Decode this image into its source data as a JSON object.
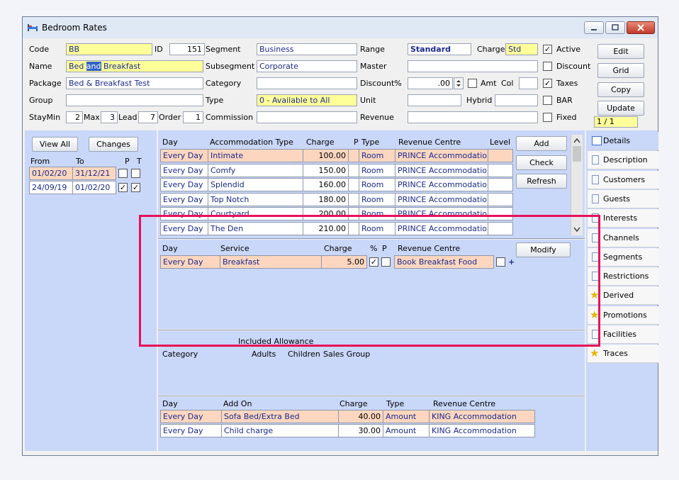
{
  "window": {
    "title": "Bedroom Rates"
  },
  "form": {
    "code_label": "Code",
    "code_value": "BB",
    "id_label": "ID",
    "id_value": "151",
    "segment_label": "Segment",
    "segment_value": "Business",
    "range_label": "Range",
    "range_value": "Standard",
    "charge_label": "Charge",
    "charge_value": "Std",
    "name_label": "Name",
    "name_pre": "Bed ",
    "name_sel": "and",
    "name_post": " Breakfast",
    "subsegment_label": "Subsegment",
    "subsegment_value": "Corporate",
    "master_label": "Master",
    "package_label": "Package",
    "package_value": "Bed & Breakfast Test",
    "category_label": "Category",
    "discount_label": "Discount%",
    "discount_value": ".00",
    "amt_label": "Amt",
    "col_label": "Col",
    "group_label": "Group",
    "type_label": "Type",
    "type_value": "0 - Available to All",
    "unit_label": "Unit",
    "hybrid_label": "Hybrid",
    "staymin_label": "StayMin",
    "staymin_value": "2",
    "max_label": "Max",
    "max_value": "3",
    "lead_label": "Lead",
    "lead_value": "7",
    "order_label": "Order",
    "order_value": "1",
    "commission_label": "Commission",
    "revenue_label": "Revenue"
  },
  "flags": {
    "active": "Active",
    "discount": "Discount",
    "taxes": "Taxes",
    "bar": "BAR",
    "fixed": "Fixed"
  },
  "actions": {
    "edit": "Edit",
    "grid": "Grid",
    "copy": "Copy",
    "update": "Update",
    "record_pos": "1 / 1"
  },
  "left": {
    "view_all": "View All",
    "changes": "Changes",
    "h_from": "From",
    "h_to": "To",
    "h_p": "P",
    "h_t": "T",
    "rows": [
      {
        "from": "01/02/20",
        "to": "31/12/21"
      },
      {
        "from": "24/09/19",
        "to": "01/02/20"
      }
    ]
  },
  "accommodation": {
    "h_day": "Day",
    "h_type": "Accommodation Type",
    "h_charge": "Charge",
    "h_p": "P",
    "h_ptype": "Type",
    "h_rev": "Revenue Centre",
    "h_level": "Level",
    "rows": [
      {
        "day": "Every Day",
        "type": "Intimate",
        "charge": "100.00",
        "ptype": "Room",
        "rev": "PRINCE Accommodatio"
      },
      {
        "day": "Every Day",
        "type": "Comfy",
        "charge": "150.00",
        "ptype": "Room",
        "rev": "PRINCE Accommodatio"
      },
      {
        "day": "Every Day",
        "type": "Splendid",
        "charge": "160.00",
        "ptype": "Room",
        "rev": "PRINCE Accommodatio"
      },
      {
        "day": "Every Day",
        "type": "Top Notch",
        "charge": "180.00",
        "ptype": "Room",
        "rev": "PRINCE Accommodatio"
      },
      {
        "day": "Every Day",
        "type": "Courtyard",
        "charge": "200.00",
        "ptype": "Room",
        "rev": "PRINCE Accommodatio"
      },
      {
        "day": "Every Day",
        "type": "The Den",
        "charge": "210.00",
        "ptype": "Room",
        "rev": "PRINCE Accommodatio"
      }
    ],
    "add": "Add",
    "check": "Check",
    "refresh": "Refresh"
  },
  "services": {
    "h_day": "Day",
    "h_service": "Service",
    "h_charge": "Charge",
    "h_pct": "%",
    "h_p": "P",
    "h_rev": "Revenue Centre",
    "modify": "Modify",
    "rows": [
      {
        "day": "Every Day",
        "service": "Breakfast",
        "charge": "5.00",
        "rev": "Book Breakfast Food",
        "plus": "+"
      }
    ]
  },
  "allowance": {
    "title": "Included Allowance",
    "h_category": "Category",
    "h_adults": "Adults",
    "h_children": "Children",
    "h_sales": "Sales Group"
  },
  "addons": {
    "h_day": "Day",
    "h_addon": "Add On",
    "h_charge": "Charge",
    "h_type": "Type",
    "h_rev": "Revenue Centre",
    "rows": [
      {
        "day": "Every Day",
        "addon": "Sofa Bed/Extra Bed",
        "charge": "40.00",
        "type": "Amount",
        "rev": "KING Accommodation"
      },
      {
        "day": "Every Day",
        "addon": "Child charge",
        "charge": "30.00",
        "type": "Amount",
        "rev": "KING Accommodation"
      }
    ]
  },
  "tabs": [
    {
      "label": "Details",
      "icon": "details-icon"
    },
    {
      "label": "Description",
      "icon": "page-icon"
    },
    {
      "label": "Customers",
      "icon": "page-icon"
    },
    {
      "label": "Guests",
      "icon": "page-icon"
    },
    {
      "label": "Interests",
      "icon": "page-icon"
    },
    {
      "label": "Channels",
      "icon": "page-icon"
    },
    {
      "label": "Segments",
      "icon": "page-icon"
    },
    {
      "label": "Restrictions",
      "icon": "page-icon"
    },
    {
      "label": "Derived",
      "icon": "star-icon"
    },
    {
      "label": "Promotions",
      "icon": "star-icon"
    },
    {
      "label": "Facilities",
      "icon": "page-icon"
    },
    {
      "label": "Traces",
      "icon": "star-icon"
    }
  ],
  "colors": {
    "highlight": "#e8105a",
    "panel": "#c9d7f9",
    "row_highlight": "#fcd6bf",
    "field_yellow": "#ffff99",
    "link_navy": "#1a2a8c"
  }
}
